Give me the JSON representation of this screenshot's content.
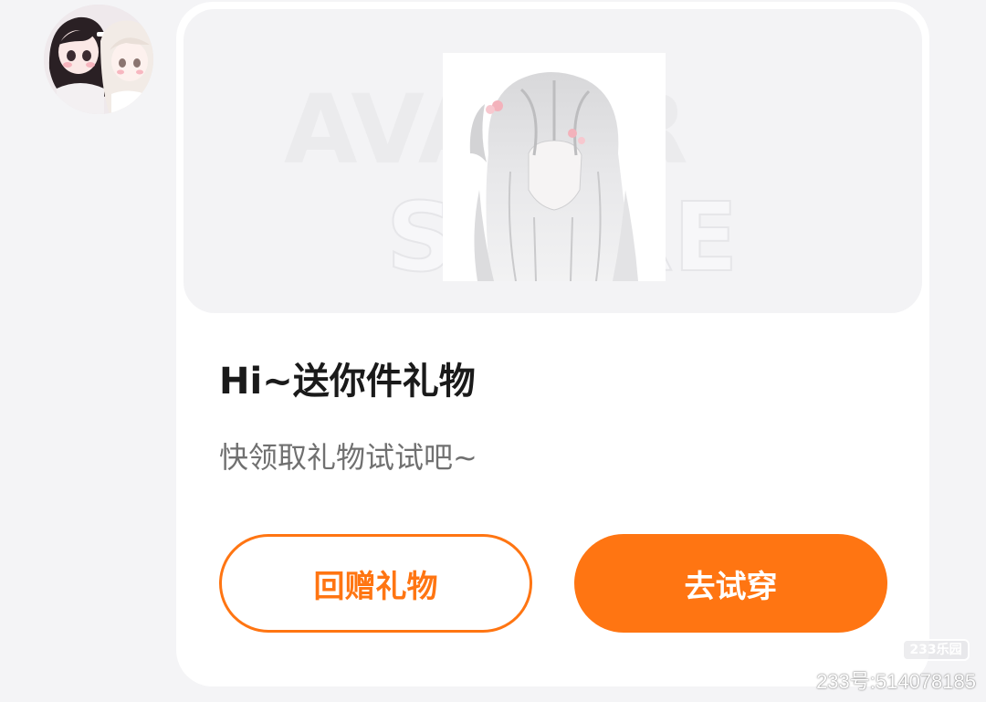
{
  "banner": {
    "watermark_line1": "AVATAR",
    "watermark_line2": "STORE"
  },
  "card": {
    "title": "Hi~送你件礼物",
    "subtitle": "快领取礼物试试吧~"
  },
  "buttons": {
    "return_gift": "回赠礼物",
    "try_on": "去试穿"
  },
  "watermark": {
    "logo_text": "233乐园",
    "id_text": "233号:514078185"
  },
  "colors": {
    "accent": "#ff7512",
    "page_background": "#f4f4f6",
    "card_background": "#ffffff",
    "title_text": "#1a1a1a",
    "subtitle_text": "#707070"
  },
  "icons": {
    "avatar": "user-avatar-image",
    "gift": "hair-item-image"
  }
}
